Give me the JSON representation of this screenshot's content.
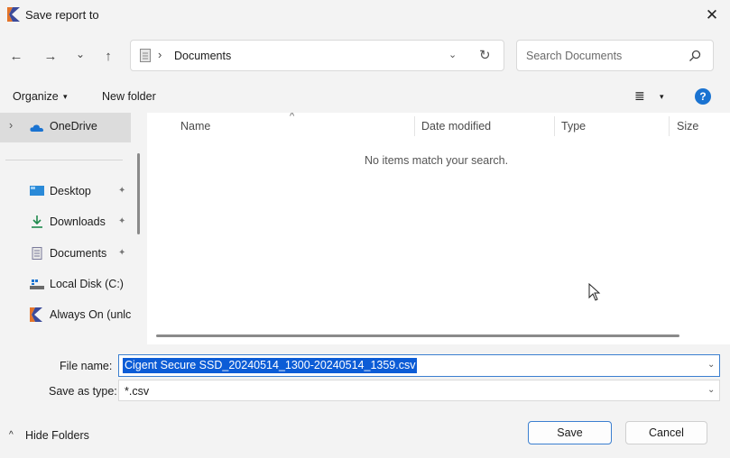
{
  "window": {
    "title": "Save report to",
    "close_label": "✕"
  },
  "nav": {
    "back_icon": "←",
    "forward_icon": "→",
    "recent_icon": "⌄",
    "up_icon": "↑",
    "address": {
      "separator": "›",
      "location": "Documents",
      "dropdown": "⌄",
      "refresh_icon": "↻"
    },
    "search": {
      "placeholder": "Search Documents"
    }
  },
  "commandbar": {
    "organize": "Organize",
    "caret": "▾",
    "new_folder": "New folder",
    "view_icon": "≣",
    "help": "?"
  },
  "sidebar": {
    "items": [
      {
        "label": "OneDrive",
        "icon": "cloud-icon",
        "pinned": false,
        "expander": "›"
      },
      {
        "label": "Desktop",
        "icon": "desktop-icon",
        "pinned": true
      },
      {
        "label": "Downloads",
        "icon": "download-icon",
        "pinned": true
      },
      {
        "label": "Documents",
        "icon": "documents-icon",
        "pinned": true
      },
      {
        "label": "Local Disk (C:)",
        "icon": "disk-icon",
        "pinned": false
      },
      {
        "label": "Always On (unlc",
        "icon": "app-icon",
        "pinned": false
      }
    ],
    "pin_glyph": "📌"
  },
  "content": {
    "columns": [
      "Name",
      "Date modified",
      "Type",
      "Size"
    ],
    "sort_indicator": "^",
    "empty_message": "No items match your search."
  },
  "form": {
    "file_name_label": "File name:",
    "file_name_value": "Cigent Secure SSD_20240514_1300-20240514_1359.csv",
    "save_type_label": "Save as type:",
    "save_type_value": "*.csv",
    "dropdown_glyph": "⌄"
  },
  "footer": {
    "hide_folders": "Hide Folders",
    "hide_caret": "^",
    "save": "Save",
    "cancel": "Cancel"
  },
  "colors": {
    "accent": "#0c5cd6",
    "help": "#1a73d1",
    "selected_nav": "#dcdcdc"
  }
}
